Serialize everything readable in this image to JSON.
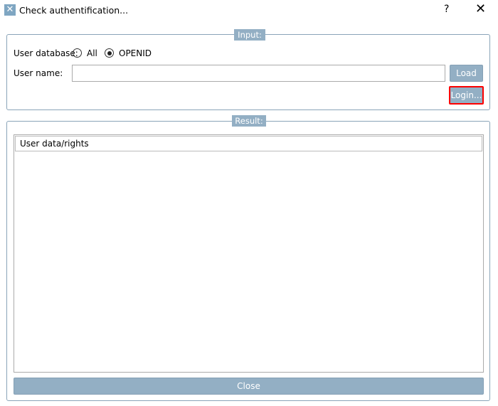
{
  "window": {
    "title": "Check authentification...",
    "help": "?",
    "close": "✕",
    "icon": "tools-icon"
  },
  "input": {
    "legend": "Input:",
    "db_label": "User database:",
    "options": [
      {
        "label": "All",
        "selected": false
      },
      {
        "label": "OPENID",
        "selected": true
      }
    ],
    "username_label": "User name:",
    "username_value": "",
    "load": "Load",
    "login": "Login..."
  },
  "result": {
    "legend": "Result:",
    "column": "User data/rights"
  },
  "footer": {
    "close": "Close"
  },
  "colors": {
    "accent": "#93afc4",
    "highlight": "#ff0000"
  }
}
